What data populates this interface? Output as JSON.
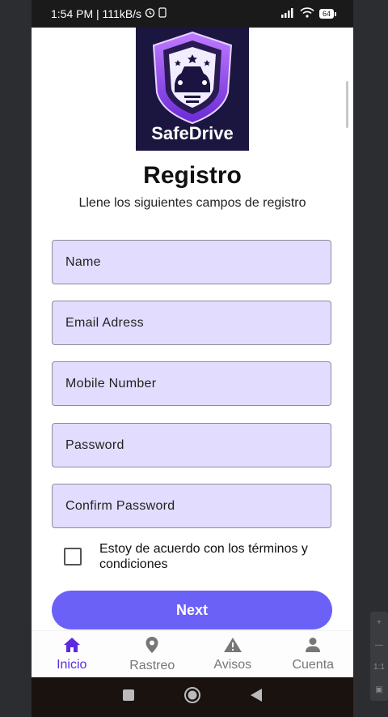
{
  "status_bar": {
    "time_speed": "1:54 PM | 111kB/s",
    "battery": "64"
  },
  "logo": {
    "text": "SafeDrive"
  },
  "header": {
    "title": "Registro",
    "subtitle": "Llene los siguientes campos de registro"
  },
  "form": {
    "fields": [
      {
        "label": "Name"
      },
      {
        "label": "Email Adress"
      },
      {
        "label": "Mobile Number"
      },
      {
        "label": "Password"
      },
      {
        "label": "Confirm Password"
      }
    ],
    "terms_label": "Estoy de acuerdo con los términos y condiciones",
    "next_label": "Next"
  },
  "bottom_nav": {
    "items": [
      {
        "label": "Inicio",
        "icon": "home-icon"
      },
      {
        "label": "Rastreo",
        "icon": "location-pin-icon"
      },
      {
        "label": "Avisos",
        "icon": "warning-icon"
      },
      {
        "label": "Cuenta",
        "icon": "person-icon"
      }
    ]
  },
  "side_tools": {
    "ratio": "1:1"
  },
  "colors": {
    "accent": "#6c61f6",
    "field_bg": "#e2dcff",
    "nav_active": "#5b2be0"
  }
}
